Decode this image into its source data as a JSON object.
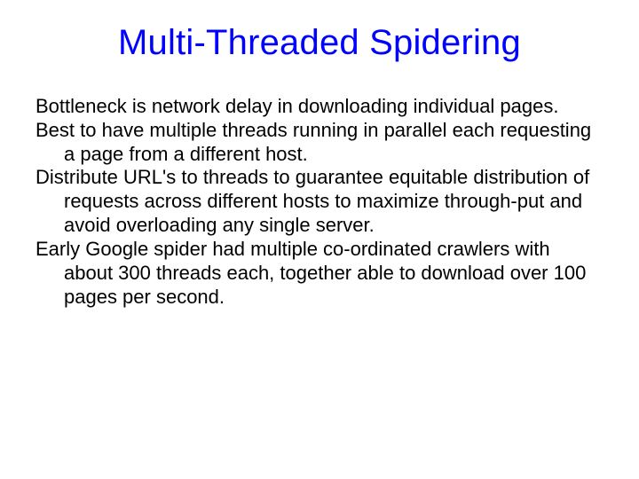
{
  "slide": {
    "title": "Multi-Threaded Spidering",
    "paragraphs": [
      "Bottleneck is network delay in downloading individual pages.",
      "Best to have multiple threads running in parallel each requesting a page from a different host.",
      "Distribute URL's to threads to guarantee equitable distribution of requests across different hosts to maximize through-put and avoid overloading any single server.",
      "Early Google spider had multiple co-ordinated crawlers with about 300 threads each, together able to download over 100 pages per second."
    ]
  }
}
